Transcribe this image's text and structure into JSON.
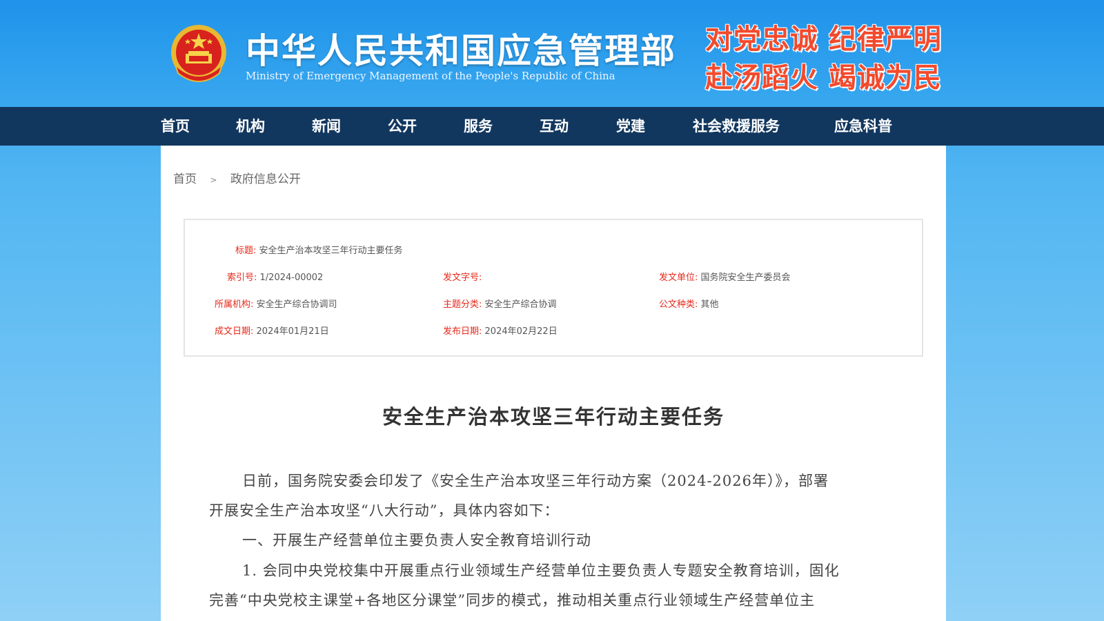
{
  "header": {
    "title": "中华人民共和国应急管理部",
    "subtitle": "Ministry of Emergency Management of the People's Republic of China",
    "slogan_line1": "对党忠诚 纪律严明",
    "slogan_line2": "赴汤蹈火 竭诚为民",
    "emblem_icon": "national-emblem-icon"
  },
  "nav": {
    "items": [
      "首页",
      "机构",
      "新闻",
      "公开",
      "服务",
      "互动",
      "党建",
      "社会救援服务",
      "应急科普"
    ]
  },
  "breadcrumb": {
    "home": "首页",
    "separator": ">",
    "current": "政府信息公开"
  },
  "meta": {
    "title_label": "标题:",
    "title_value": "安全生产治本攻坚三年行动主要任务",
    "index_label": "索引号:",
    "index_value": "1/2024-00002",
    "docno_label": "发文字号:",
    "docno_value": "",
    "issuer_label": "发文单位:",
    "issuer_value": "国务院安全生产委员会",
    "org_label": "所属机构:",
    "org_value": "安全生产综合协调司",
    "topic_label": "主题分类:",
    "topic_value": "安全生产综合协调",
    "type_label": "公文种类:",
    "type_value": "其他",
    "created_label": "成文日期:",
    "created_value": "2024年01月21日",
    "published_label": "发布日期:",
    "published_value": "2024年02月22日"
  },
  "article": {
    "title": "安全生产治本攻坚三年行动主要任务",
    "p1_line1": "日前，国务院安委会印发了《安全生产治本攻坚三年行动方案（2024-2026年）》，部署",
    "p1_line2": "开展安全生产治本攻坚“八大行动”，具体内容如下：",
    "p2": "一、开展生产经营单位主要负责人安全教育培训行动",
    "p3_line1": "1. 会同中央党校集中开展重点行业领域生产经营单位主要负责人专题安全教育培训，固化",
    "p3_line2": "完善“中央党校主课堂+各地区分课堂”同步的模式，推动相关重点行业领域生产经营单位主"
  },
  "colors": {
    "header_blue": "#1f93ea",
    "nav_navy": "#12375f",
    "slogan_red": "#f24a2d",
    "meta_label_red": "#e5291b"
  }
}
